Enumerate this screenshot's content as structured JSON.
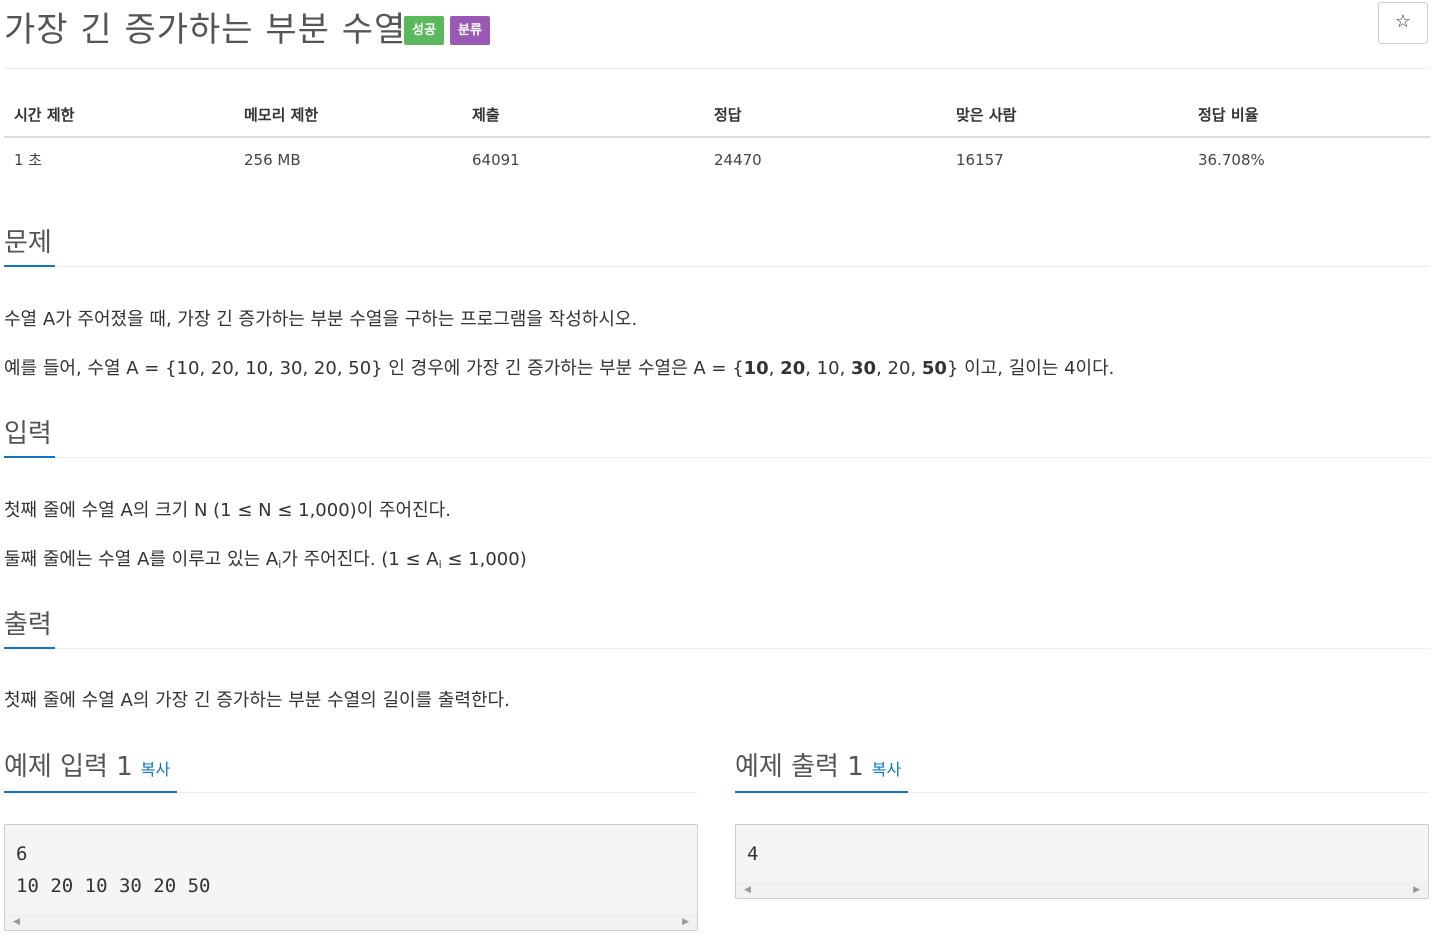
{
  "header": {
    "title": "가장 긴 증가하는 부분 수열",
    "badge_success": "성공",
    "badge_category": "분류",
    "star": "☆"
  },
  "info_table": {
    "headers": [
      "시간 제한",
      "메모리 제한",
      "제출",
      "정답",
      "맞은 사람",
      "정답 비율"
    ],
    "values": [
      "1 초",
      "256 MB",
      "64091",
      "24470",
      "16157",
      "36.708%"
    ]
  },
  "problem": {
    "heading": "문제",
    "line1": "수열 A가 주어졌을 때, 가장 긴 증가하는 부분 수열을 구하는 프로그램을 작성하시오.",
    "line2_prefix": "예를 들어, 수열 A = {10, 20, 10, 30, 20, 50} 인 경우에 가장 긴 증가하는 부분 수열은 A = {",
    "line2_b1": "10",
    "line2_s1": ", ",
    "line2_b2": "20",
    "line2_s2": ", 10, ",
    "line2_b3": "30",
    "line2_s3": ", 20, ",
    "line2_b4": "50",
    "line2_suffix": "} 이고, 길이는 4이다."
  },
  "input": {
    "heading": "입력",
    "line1": "첫째 줄에 수열 A의 크기 N (1 ≤ N ≤ 1,000)이 주어진다.",
    "line2_a": "둘째 줄에는 수열 A를 이루고 있는 A",
    "line2_sub1": "i",
    "line2_b": "가 주어진다. (1 ≤ A",
    "line2_sub2": "i",
    "line2_c": " ≤ 1,000)"
  },
  "output": {
    "heading": "출력",
    "line1": "첫째 줄에 수열 A의 가장 긴 증가하는 부분 수열의 길이를 출력한다."
  },
  "sample_input": {
    "heading": "예제 입력 1",
    "copy": "복사",
    "content": "6\n10 20 10 30 20 50"
  },
  "sample_output": {
    "heading": "예제 출력 1",
    "copy": "복사",
    "content": "4"
  },
  "colors": {
    "accent": "#0e76c4",
    "success": "#5cb85c",
    "category": "#9b59b6"
  }
}
